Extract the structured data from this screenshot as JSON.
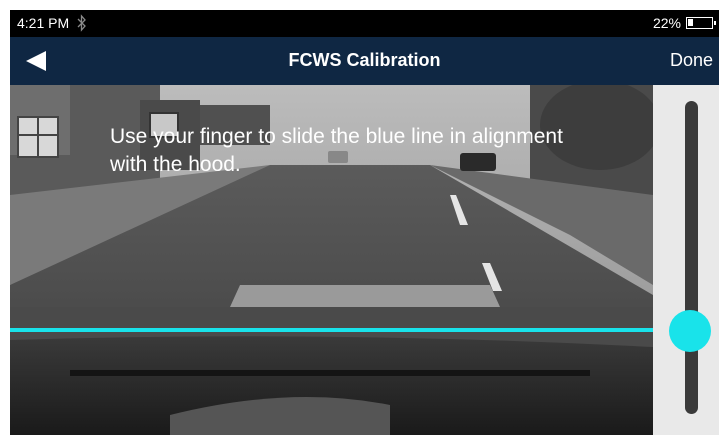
{
  "status_bar": {
    "time": "4:21 PM",
    "bluetooth_icon": "bluetooth-icon",
    "battery_percent": "22%",
    "battery_level": 0.22,
    "battery_icon": "battery-icon"
  },
  "header": {
    "title": "FCWS Calibration",
    "back_icon": "back-arrow-icon",
    "done_label": "Done",
    "background": "#0f2743"
  },
  "camera_view": {
    "instruction": "Use your finger to slide the blue line in alignment with the hood."
  },
  "calibration": {
    "line_color": "#19e3ea",
    "slider_level": 0.26
  }
}
